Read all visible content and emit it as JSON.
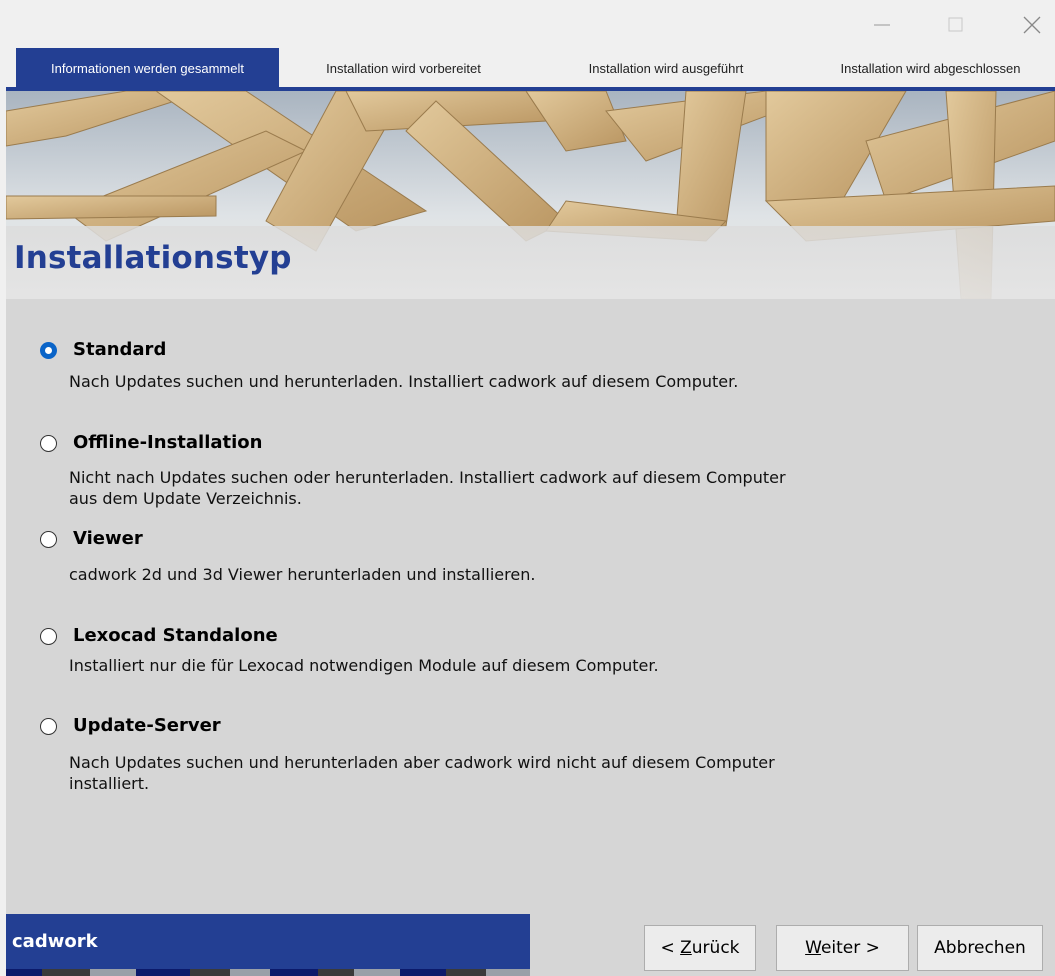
{
  "window": {
    "controls": {
      "minimize": "minimize-icon",
      "maximize": "maximize-icon",
      "close": "close-icon"
    }
  },
  "steps": [
    {
      "label": "Informationen werden gesammelt",
      "active": true
    },
    {
      "label": "Installation wird vorbereitet",
      "active": false
    },
    {
      "label": "Installation wird ausgeführt",
      "active": false
    },
    {
      "label": "Installation wird abgeschlossen",
      "active": false
    }
  ],
  "page": {
    "title": "Installationstyp"
  },
  "options": [
    {
      "label": "Standard",
      "description": "Nach Updates suchen und herunterladen. Installiert cadwork auf diesem Computer.",
      "checked": true
    },
    {
      "label": "Offline-Installation",
      "description": "Nicht nach Updates suchen oder herunterladen. Installiert cadwork auf diesem Computer\naus dem Update Verzeichnis.",
      "checked": false
    },
    {
      "label": "Viewer",
      "description": "cadwork 2d und 3d Viewer herunterladen und installieren.",
      "checked": false
    },
    {
      "label": "Lexocad Standalone",
      "description": "Installiert nur die für Lexocad notwendigen Module auf diesem Computer.",
      "checked": false
    },
    {
      "label": "Update-Server",
      "description": "Nach Updates suchen und herunterladen aber cadwork wird nicht auf diesem Computer\ninstalliert.",
      "checked": false
    }
  ],
  "footer": {
    "brand": "cadwork",
    "back": {
      "prefix": "< ",
      "mnemonic": "Z",
      "rest": "urück"
    },
    "next": {
      "mnemonic": "W",
      "rest": "eiter >"
    },
    "cancel": "Abbrechen"
  },
  "colors": {
    "accent": "#233f93",
    "radio_checked": "#0a64c8",
    "background": "#d6d6d6"
  }
}
